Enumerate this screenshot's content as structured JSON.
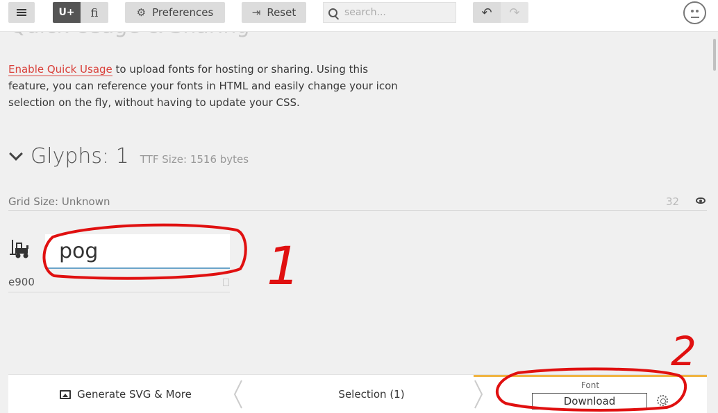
{
  "toolbar": {
    "unicode_toggle": "U+",
    "ligature_toggle": "ﬁ",
    "preferences_label": "Preferences",
    "reset_label": "Reset",
    "search_placeholder": "search...",
    "undo_symbol": "↶",
    "redo_symbol": "↷"
  },
  "ghost_heading": "Quick Usage & Sharing",
  "quick_usage": {
    "link_text": "Enable Quick Usage",
    "text": " to upload fonts for hosting or sharing. Using this feature, you can reference your fonts in HTML and easily change your icon selection on the fly, without having to update your CSS."
  },
  "glyphs": {
    "title": "Glyphs: 1",
    "ttf_size": "TTF Size: 1516 bytes",
    "grid_size_label": "Grid Size: Unknown",
    "grid_value": "32"
  },
  "glyph_item": {
    "icon": "forklift-icon",
    "name_value": "pog",
    "codepoint": "e900"
  },
  "annotations": {
    "first": "1",
    "second": "2",
    "color": "#e01010"
  },
  "bottom_bar": {
    "generate_label": "Generate SVG & More",
    "selection_label": "Selection (1)",
    "font_label": "Font",
    "download_label": "Download",
    "accent_color": "#f0b443"
  }
}
